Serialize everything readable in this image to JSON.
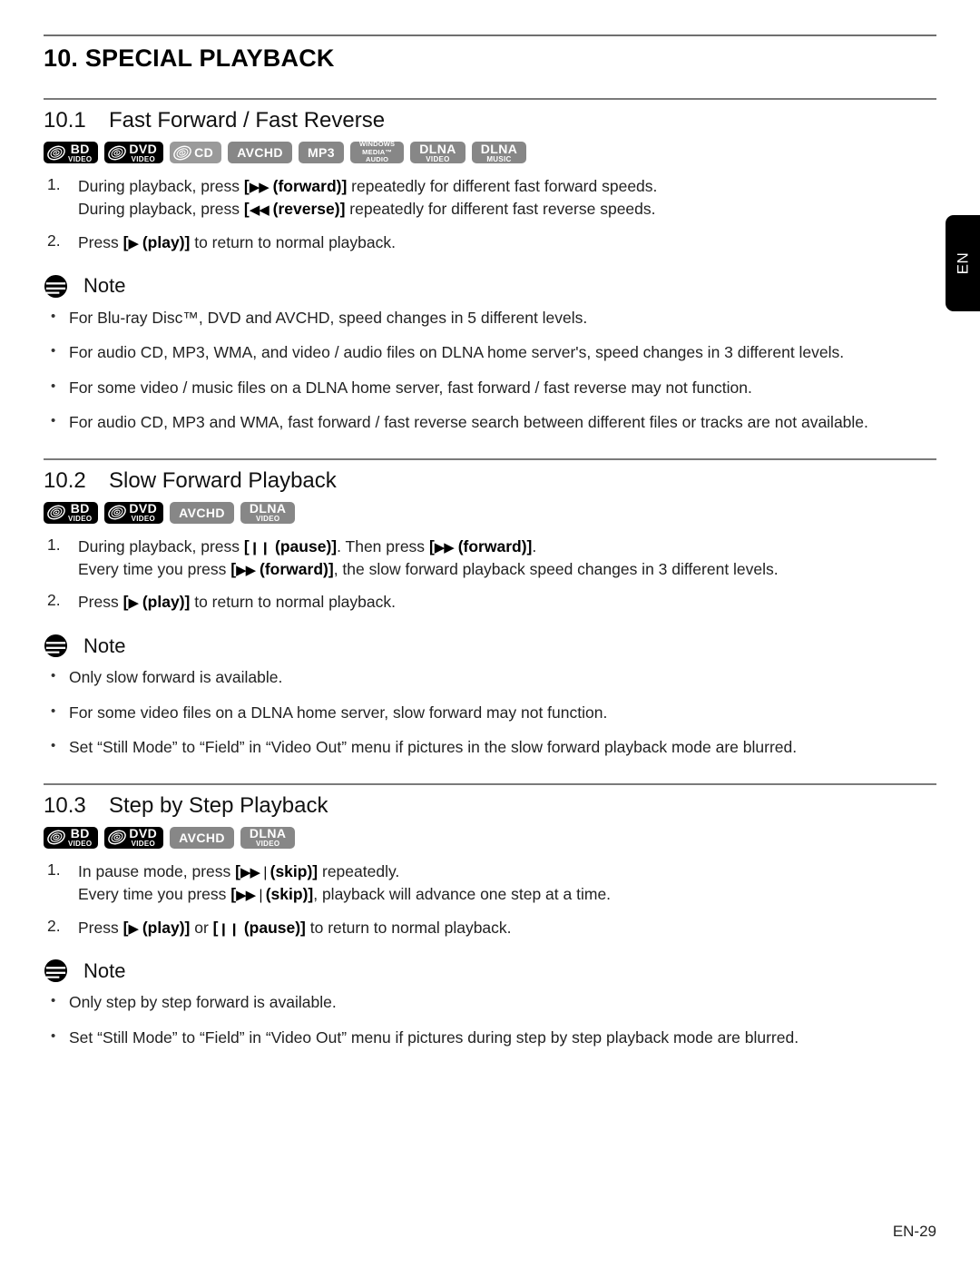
{
  "page": {
    "chapter_title": "10. SPECIAL PLAYBACK",
    "language_tab": "EN",
    "footer": "EN-29",
    "note_label": "Note"
  },
  "badge_defs": {
    "bd_video": {
      "main": "BD",
      "sub": "Video",
      "style": "dark",
      "disc": true
    },
    "dvd_video": {
      "main": "DVD",
      "sub": "Video",
      "style": "dark",
      "disc": true
    },
    "cd": {
      "main": "CD",
      "sub": "",
      "style": "disc-gray",
      "disc": true
    },
    "avchd": {
      "main": "AVCHD",
      "sub": "",
      "style": "gray",
      "disc": false
    },
    "mp3": {
      "main": "MP3",
      "sub": "",
      "style": "gray",
      "disc": false
    },
    "wma": {
      "lines": [
        "WINDOWS",
        "MEDIA™",
        "AUDIO"
      ],
      "style": "gray",
      "disc": false
    },
    "dlna_video": {
      "main": "DLNA",
      "sub": "Video",
      "style": "gray",
      "disc": false
    },
    "dlna_music": {
      "main": "DLNA",
      "sub": "Music",
      "style": "gray",
      "disc": false
    }
  },
  "sections": [
    {
      "number": "10.1",
      "name": "Fast Forward / Fast Reverse",
      "badges": [
        "bd_video",
        "dvd_video",
        "cd",
        "avchd",
        "mp3",
        "wma",
        "dlna_video",
        "dlna_music"
      ],
      "steps": [
        {
          "num": "1.",
          "lines": [
            {
              "pre": "During playback, press ",
              "key": "[▶▶ (forward)]",
              "post": " repeatedly for different fast forward speeds."
            },
            {
              "pre": "During playback, press ",
              "key": "[◀◀ (reverse)]",
              "post": " repeatedly for different fast reverse speeds."
            }
          ]
        },
        {
          "num": "2.",
          "lines": [
            {
              "pre": "Press ",
              "key": "[▶ (play)]",
              "post": " to return to normal playback."
            }
          ]
        }
      ],
      "notes": [
        "For Blu-ray Disc™, DVD and AVCHD, speed changes in 5 different levels.",
        "For audio CD, MP3, WMA, and video / audio files on DLNA home server's, speed changes in 3 different levels.",
        "For some video / music files on a DLNA home server, fast forward / fast reverse may not function.",
        "For audio CD, MP3 and WMA, fast forward / fast reverse search between different files or tracks are not available."
      ]
    },
    {
      "number": "10.2",
      "name": "Slow Forward Playback",
      "badges": [
        "bd_video",
        "dvd_video",
        "avchd",
        "dlna_video"
      ],
      "steps": [
        {
          "num": "1.",
          "lines": [
            {
              "pre": "During playback, press ",
              "key": "[❙❙ (pause)]",
              "post": ". Then press ",
              "key2": "[▶▶ (forward)]",
              "post2": "."
            },
            {
              "pre": "Every time you press ",
              "key": "[▶▶ (forward)]",
              "post": ", the slow forward playback speed changes in 3 different levels."
            }
          ]
        },
        {
          "num": "2.",
          "lines": [
            {
              "pre": "Press ",
              "key": "[▶ (play)]",
              "post": " to return to normal playback."
            }
          ]
        }
      ],
      "notes": [
        "Only slow forward is available.",
        "For some video files on a DLNA home server, slow forward may not function.",
        "Set “Still Mode” to “Field” in “Video Out” menu if pictures in the slow forward playback mode are blurred."
      ]
    },
    {
      "number": "10.3",
      "name": "Step by Step Playback",
      "badges": [
        "bd_video",
        "dvd_video",
        "avchd",
        "dlna_video"
      ],
      "steps": [
        {
          "num": "1.",
          "lines": [
            {
              "pre": "In pause mode, press ",
              "key": "[▶▶❘(skip)]",
              "post": " repeatedly."
            },
            {
              "pre": "Every time you press ",
              "key": "[▶▶❘(skip)]",
              "post": ", playback will advance one step at a time."
            }
          ]
        },
        {
          "num": "2.",
          "lines": [
            {
              "pre": "Press ",
              "key": "[▶ (play)]",
              "post": " or ",
              "key2": "[❙❙ (pause)]",
              "post2": " to return to normal playback."
            }
          ]
        }
      ],
      "notes": [
        "Only step by step forward is available.",
        "Set “Still Mode” to “Field” in “Video Out” menu if pictures during step by step playback mode are blurred."
      ]
    }
  ],
  "bullet_char": "•"
}
